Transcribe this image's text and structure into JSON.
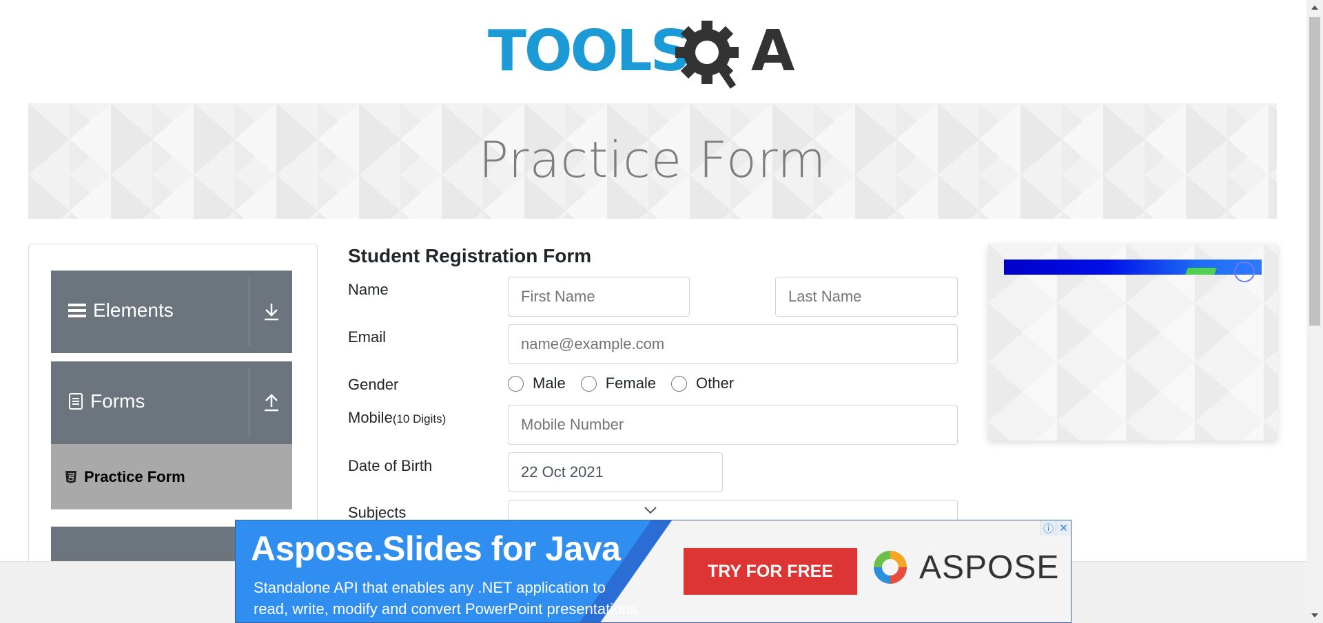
{
  "logo": {
    "text_left": "TOOLS",
    "text_right": "A",
    "colors": {
      "blue": "#1b9ad6",
      "dark": "#333333"
    }
  },
  "banner": {
    "title": "Practice Form"
  },
  "sidebar": {
    "groups": [
      {
        "label": "Elements",
        "icon": "hamburger-icon",
        "toggle_icon": "download-arrow-icon"
      },
      {
        "label": "Forms",
        "icon": "document-icon",
        "toggle_icon": "upload-arrow-icon"
      }
    ],
    "active_item": {
      "label": "Practice Form",
      "icon": "html5-icon"
    },
    "colors": {
      "group_bg": "#6c757d",
      "active_bg": "#a9a9a9"
    }
  },
  "form": {
    "title": "Student Registration Form",
    "name": {
      "label": "Name",
      "first_placeholder": "First Name",
      "last_placeholder": "Last Name"
    },
    "email": {
      "label": "Email",
      "placeholder": "name@example.com"
    },
    "gender": {
      "label": "Gender",
      "options": [
        "Male",
        "Female",
        "Other"
      ]
    },
    "mobile": {
      "label": "Mobile",
      "hint": "(10 Digits)",
      "placeholder": "Mobile Number"
    },
    "dob": {
      "label": "Date of Birth",
      "value": "22 Oct 2021"
    },
    "subjects": {
      "label": "Subjects"
    }
  },
  "bottom_ad": {
    "headline": "Aspose.Slides for Java",
    "sub_line1": "Standalone API that enables any .NET application to",
    "sub_line2": "read, write, modify and convert PowerPoint presentations.",
    "cta": "TRY FOR FREE",
    "brand": "ASPOSE",
    "colors": {
      "bg": "#2f8ef0",
      "cta": "#dd3434"
    }
  }
}
